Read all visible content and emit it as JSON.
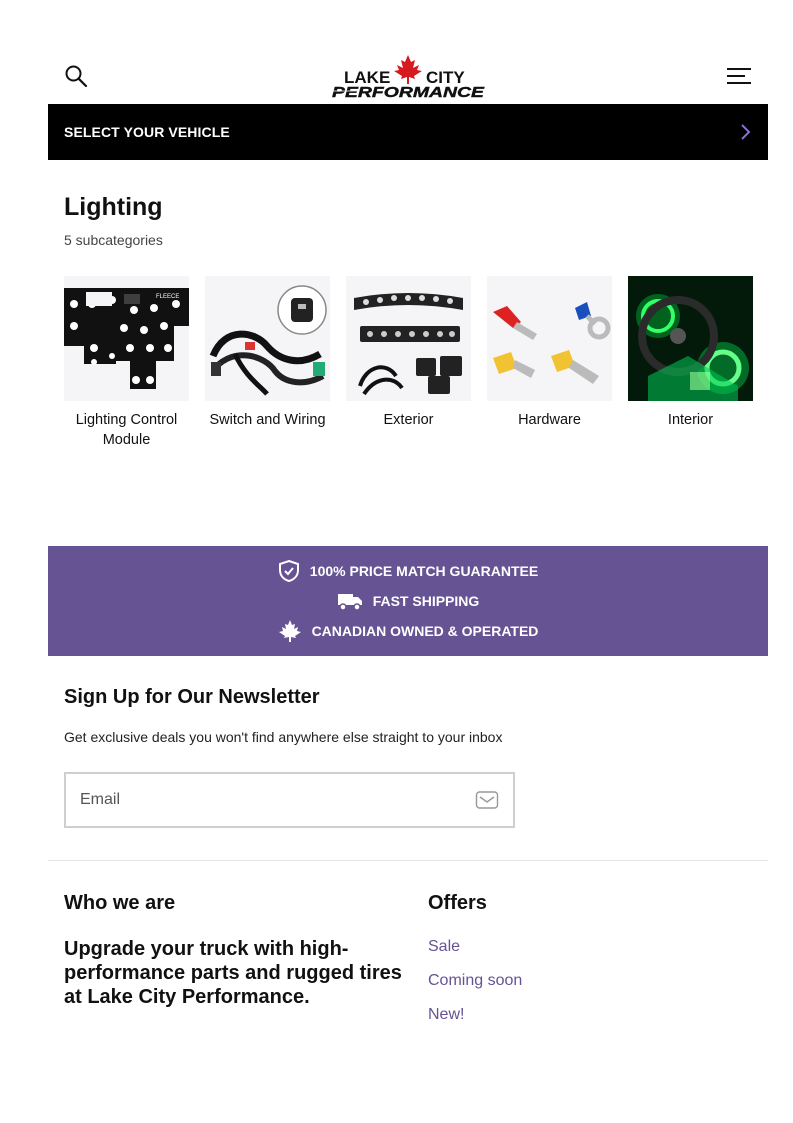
{
  "header": {
    "logo_line1": "LAKE",
    "logo_line1b": "CITY",
    "logo_line2": "PERFORMANCE",
    "search_icon": "search-icon",
    "menu_icon": "hamburger-menu-icon"
  },
  "vehicle_bar": {
    "label": "SELECT YOUR VEHICLE",
    "icon": "chevron-right-icon"
  },
  "category": {
    "title": "Lighting",
    "subtitle": "5 subcategories",
    "items": [
      {
        "label": "Lighting Control Module"
      },
      {
        "label": "Switch and Wiring"
      },
      {
        "label": "Exterior"
      },
      {
        "label": "Hardware"
      },
      {
        "label": "Interior"
      }
    ]
  },
  "banner": {
    "items": [
      {
        "label": "100% PRICE MATCH GUARANTEE",
        "icon": "shield-check-icon"
      },
      {
        "label": "FAST SHIPPING",
        "icon": "truck-icon"
      },
      {
        "label": "CANADIAN OWNED & OPERATED",
        "icon": "maple-leaf-icon"
      }
    ],
    "color": "#665393"
  },
  "newsletter": {
    "title": "Sign Up for Our Newsletter",
    "description": "Get exclusive deals you won't find anywhere else straight to your inbox",
    "email_placeholder": "Email",
    "email_value": ""
  },
  "footer": {
    "who_title": "Who we are",
    "who_text": "Upgrade your truck with high-performance parts and rugged tires at Lake City Performance.",
    "offers_title": "Offers",
    "offers_links": [
      {
        "label": "Sale"
      },
      {
        "label": "Coming soon"
      },
      {
        "label": "New!"
      }
    ],
    "link_color": "#665393"
  }
}
